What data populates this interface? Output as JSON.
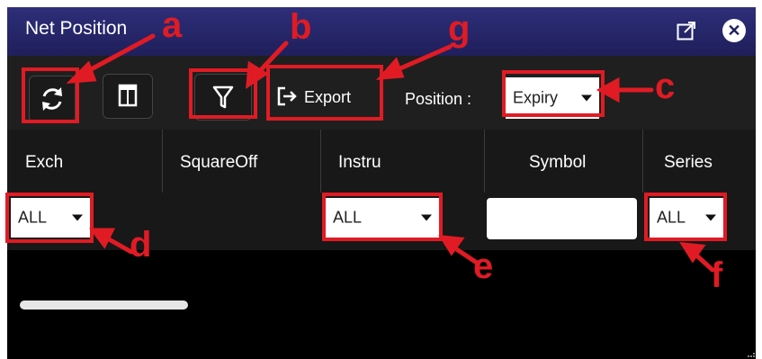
{
  "window": {
    "title": "Net Position",
    "popout_icon": "popout-icon",
    "close_icon": "close-icon"
  },
  "toolbar": {
    "refresh_icon": "refresh-icon",
    "columns_icon": "columns-icon",
    "filter_icon": "filter-icon",
    "export_label": "Export",
    "position_label": "Position :",
    "position_value": "Expiry"
  },
  "columns": [
    "Exch",
    "SquareOff",
    "Instru",
    "Symbol",
    "Series"
  ],
  "filters": {
    "exch": "ALL",
    "instru": "ALL",
    "symbol": "",
    "series": "ALL"
  },
  "annotations": {
    "a": "a",
    "b": "b",
    "c": "c",
    "d": "d",
    "e": "e",
    "f": "f",
    "g": "g",
    "color": "#e01b24"
  },
  "colors": {
    "titlebar": "#1f1f5c",
    "toolbar": "#1f1f1f",
    "grid": "#181818",
    "body": "#000000"
  }
}
